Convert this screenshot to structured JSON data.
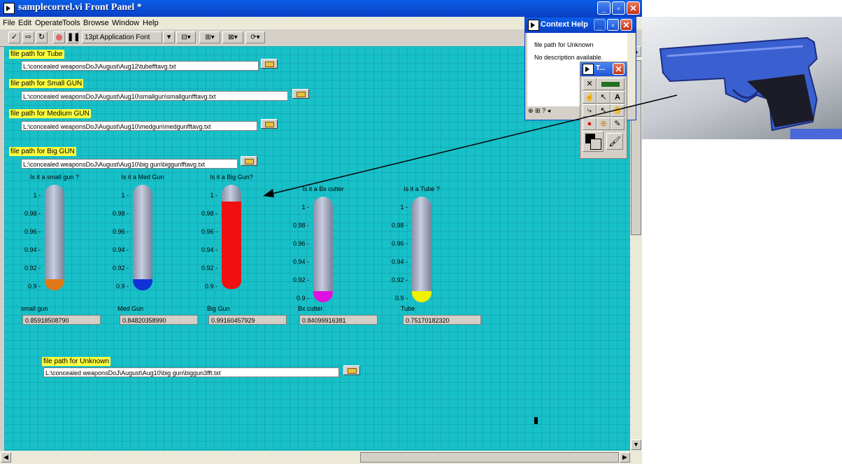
{
  "window": {
    "title": "samplecorrel.vi Front Panel *",
    "buttons": {
      "minimize": "_",
      "maximize": "▫",
      "close": "✕"
    }
  },
  "menu": [
    "File",
    "Edit",
    "Operate",
    "Tools",
    "Browse",
    "Window",
    "Help"
  ],
  "toolbar": {
    "font_select": "13pt Application Font"
  },
  "file_paths": [
    {
      "label": "file path for Tube",
      "value": "L:\\concealed weaponsDoJ\\August\\Aug12\\tubefftavg.txt"
    },
    {
      "label": "file path for Small GUN",
      "value": "L:\\concealed weaponsDoJ\\August\\Aug10\\smallgun\\smallgunfftavg.txt"
    },
    {
      "label": "file path for Medium GUN",
      "value": "L:\\concealed weaponsDoJ\\August\\Aug10\\medgun\\medgunfftavg.txt"
    },
    {
      "label": "file path for Big GUN",
      "value": "L:\\concealed weaponsDoJ\\August\\Aug10\\big gun\\biggunfftavg.txt"
    },
    {
      "label": "file path for Unknown",
      "value": "L:\\concealed weaponsDoJ\\August\\Aug10\\big gun\\biggun3fft.txt"
    }
  ],
  "thermometers": [
    {
      "title": "Is it a small gun ?",
      "caption": "small gun",
      "value": "0.85918508790",
      "level": 0.0,
      "color": "#e07818",
      "ticks": [
        "1",
        "0.98",
        "0.96",
        "0.94",
        "0.92",
        "0.9"
      ]
    },
    {
      "title": "Is it a Med Gun",
      "caption": "Med Gun",
      "value": "0.84820358990",
      "level": 0.0,
      "color": "#1030d8",
      "ticks": [
        "1",
        "0.98",
        "0.96",
        "0.94",
        "0.92",
        "0.9"
      ]
    },
    {
      "title": "Is it a Big Gun?",
      "caption": "Big Gun",
      "value": "0.99160457929",
      "level": 0.9916,
      "color": "#f01010",
      "ticks": [
        "1",
        "0.98",
        "0.96",
        "0.94",
        "0.92",
        "0.9"
      ]
    },
    {
      "title": "Is it a Bx cutter",
      "caption": "Bx cutter",
      "value": "0.84099916381",
      "level": 0.0,
      "color": "#e010e0",
      "ticks": [
        "1",
        "0.98",
        "0.96",
        "0.94",
        "0.92",
        "0.9"
      ]
    },
    {
      "title": "Is it a Tube ?",
      "caption": "Tube",
      "value": "0.75170182320",
      "level": 0.0,
      "color": "#f0f000",
      "ticks": [
        "1",
        "0.98",
        "0.96",
        "0.94",
        "0.92",
        "0.9"
      ]
    }
  ],
  "context_help": {
    "title": "Context Help",
    "line1": "file path for Unknown",
    "line2": "No description available."
  },
  "tools_palette": {
    "title": "T..."
  }
}
